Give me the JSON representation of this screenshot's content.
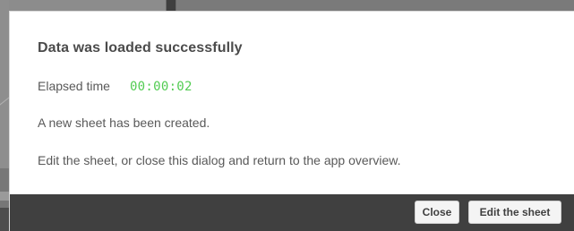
{
  "dialog": {
    "title": "Data was loaded successfully",
    "elapsed_label": "Elapsed time",
    "elapsed_value": "00:00:02",
    "message_1": "A new sheet has been created.",
    "message_2": "Edit the sheet, or close this dialog and return to the app overview.",
    "buttons": {
      "close_label": "Close",
      "edit_label": "Edit the sheet"
    }
  },
  "colors": {
    "elapsed_value": "#52cc52",
    "footer_background": "#404040",
    "dialog_background": "#ffffff",
    "text": "#595959",
    "title": "#4b4b4b"
  }
}
